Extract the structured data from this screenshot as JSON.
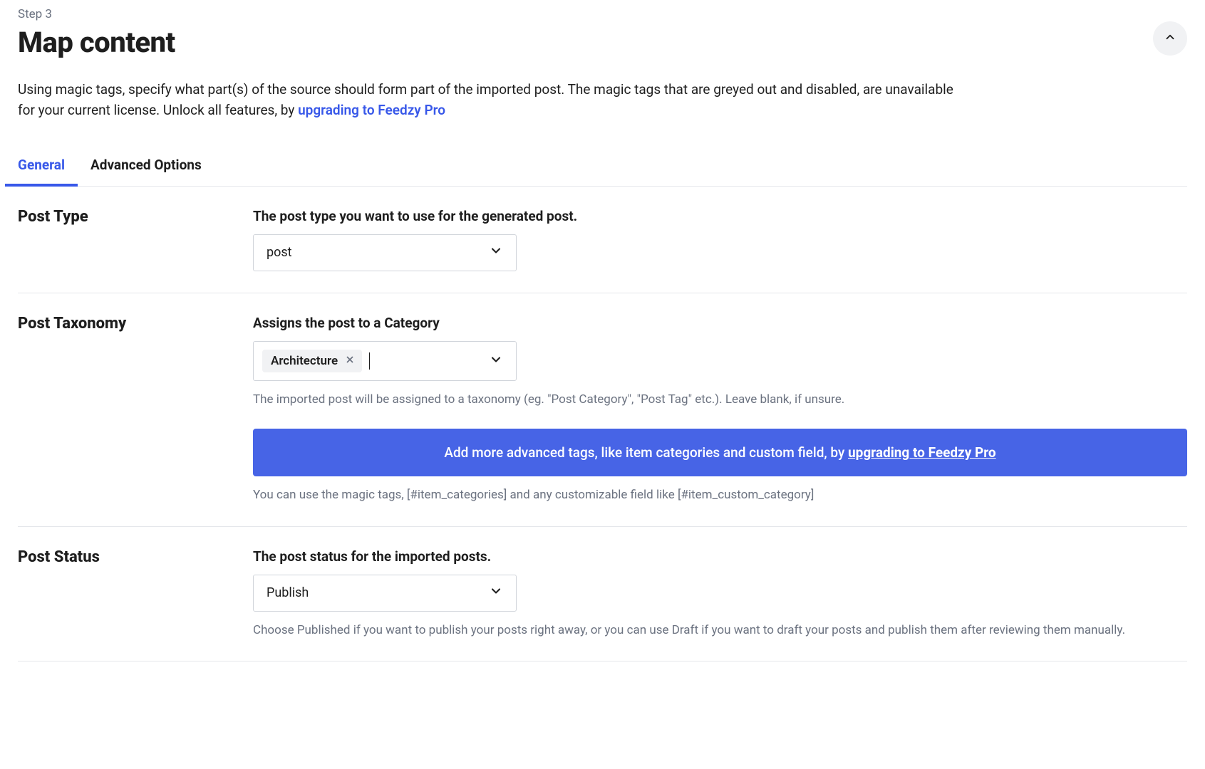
{
  "step_label": "Step 3",
  "page_title": "Map content",
  "intro_before": "Using magic tags, specify what part(s) of the source should form part of the imported post. The magic tags that are greyed out and disabled, are unavailable for your current license. Unlock all features, by ",
  "intro_link": "upgrading to Feedzy Pro",
  "tabs": {
    "general": "General",
    "advanced": "Advanced Options"
  },
  "post_type": {
    "section_label": "Post Type",
    "field_label": "The post type you want to use for the generated post.",
    "value": "post"
  },
  "post_taxonomy": {
    "section_label": "Post Taxonomy",
    "field_label": "Assigns the post to a Category",
    "tag": "Architecture",
    "help1": "The imported post will be assigned to a taxonomy (eg. \"Post Category\", \"Post Tag\" etc.). Leave blank, if unsure.",
    "promo_before": "Add more advanced tags, like item categories and custom field, by ",
    "promo_link": "upgrading to Feedzy Pro",
    "help2": "You can use the magic tags, [#item_categories] and any customizable field like [#item_custom_category]"
  },
  "post_status": {
    "section_label": "Post Status",
    "field_label": "The post status for the imported posts.",
    "value": "Publish",
    "help": "Choose Published if you want to publish your posts right away, or you can use Draft if you want to draft your posts and publish them after reviewing them manually."
  }
}
